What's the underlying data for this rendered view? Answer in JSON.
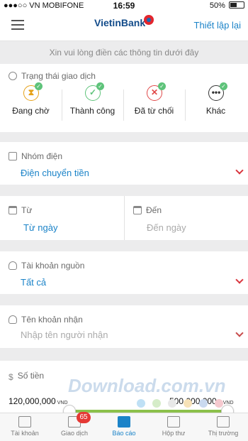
{
  "status_bar": {
    "carrier": "●●●○○ VN MOBIFONE",
    "time": "16:59",
    "battery": "50%"
  },
  "header": {
    "logo": "VietinBank",
    "action": "Thiết lập lại"
  },
  "hint": "Xin vui lòng điền các thông tin dưới đây",
  "transaction_status": {
    "label": "Trạng thái giao dịch",
    "items": [
      {
        "label": "Đang chờ",
        "symbol": "⧗",
        "color": "#e6a117"
      },
      {
        "label": "Thành công",
        "symbol": "✓",
        "color": "#5ec37a"
      },
      {
        "label": "Đã từ chối",
        "symbol": "✕",
        "color": "#e04848"
      },
      {
        "label": "Khác",
        "symbol": "•••",
        "color": "#333333"
      }
    ]
  },
  "group": {
    "label": "Nhóm điện",
    "value": "Điện chuyển tiền"
  },
  "date_range": {
    "from_label": "Từ",
    "from_value": "Từ ngày",
    "to_label": "Đến",
    "to_value": "Đến ngày"
  },
  "source_account": {
    "label": "Tài khoản nguồn",
    "value": "Tất cả"
  },
  "recipient": {
    "label": "Tên khoản nhận",
    "placeholder": "Nhập tên người nhận"
  },
  "amount": {
    "label": "Số tiền",
    "min": "120,000,000",
    "min_currency": "VND",
    "max": "500,000,000+",
    "max_currency": "VND"
  },
  "tabs": [
    {
      "label": "Tài khoản",
      "badge": ""
    },
    {
      "label": "Giao dịch",
      "badge": "65"
    },
    {
      "label": "Báo cáo",
      "badge": ""
    },
    {
      "label": "Hộp thư",
      "badge": ""
    },
    {
      "label": "Thị trường",
      "badge": ""
    }
  ],
  "watermark": "Download.com.vn",
  "colors": {
    "accent": "#1b83c8",
    "slider": "#8cc04b",
    "chevron": "#d9363e"
  }
}
